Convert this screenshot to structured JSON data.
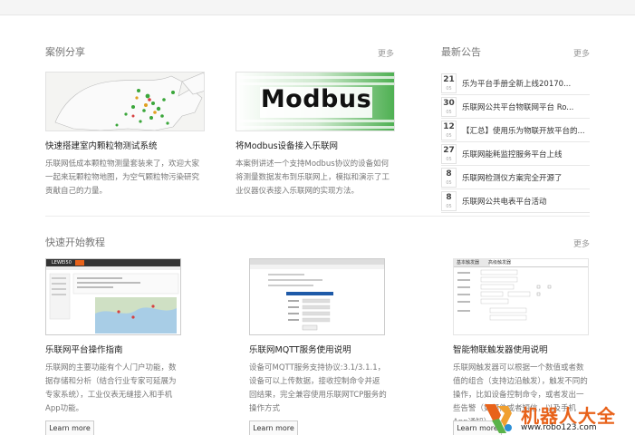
{
  "cases": {
    "title": "案例分享",
    "more": "更多",
    "items": [
      {
        "title": "快速搭建室内颗粒物测试系统",
        "desc": "乐联网低成本颗粒物测量套装来了，欢迎大家一起来玩颗粒物地图，为空气颗粒物污染研究贡献自己的力量。"
      },
      {
        "title": "将Modbus设备接入乐联网",
        "desc": "本案例讲述一个支持Modbus协议的设备如何将测量数据发布到乐联网上，模拟和演示了工业仪器仪表接入乐联网的实现方法。",
        "thumb_text": "Modbus"
      }
    ]
  },
  "notices": {
    "title": "最新公告",
    "more": "更多",
    "items": [
      {
        "day": "21",
        "month": "05",
        "text": "乐为平台手册全新上线20170..."
      },
      {
        "day": "30",
        "month": "05",
        "text": "乐联网公共平台物联网平台 Ro..."
      },
      {
        "day": "12",
        "month": "05",
        "text": "【汇总】使用乐为物联开放平台的..."
      },
      {
        "day": "27",
        "month": "05",
        "text": "乐联网能耗监控服务平台上线"
      },
      {
        "day": "8",
        "month": "05",
        "text": "乐联网检测仪方案完全开源了"
      },
      {
        "day": "8",
        "month": "05",
        "text": "乐联网公共电表平台活动"
      }
    ]
  },
  "guides": {
    "title": "快速开始教程",
    "more": "更多",
    "button": "Learn more",
    "items": [
      {
        "title": "乐联网平台操作指南",
        "desc": "乐联网的主要功能有个人门户功能，数据存储和分析（结合行业专家可延展为专家系统），工业仪表无缝接入和手机App功能。",
        "thumb_brand": "LEWEI50"
      },
      {
        "title": "乐联网MQTT服务使用说明",
        "desc": "设备可MQTT服务支持协议:3.1/3.1.1，设备可以上传数据，接收控制命令并返回结果，完全兼容使用乐联网TCP服务的操作方式"
      },
      {
        "title": "智能物联触发器使用说明",
        "desc": "乐联网触发器可以根据一个数值或者数值的组合（支持边沿触发），触发不同的操作，比如设备控制命令，或者发出一些告警（如邮件或者短信，以及手机App通知）。",
        "thumb_tabs": [
          "基本触发器",
          "高级触发器"
        ]
      }
    ]
  },
  "watermark": {
    "name": "机器人大全",
    "url": "www.robo123.com"
  },
  "colors": {
    "accent": "#e8621a",
    "modbus_green": "#4caf50",
    "nav_dark": "#333333"
  }
}
